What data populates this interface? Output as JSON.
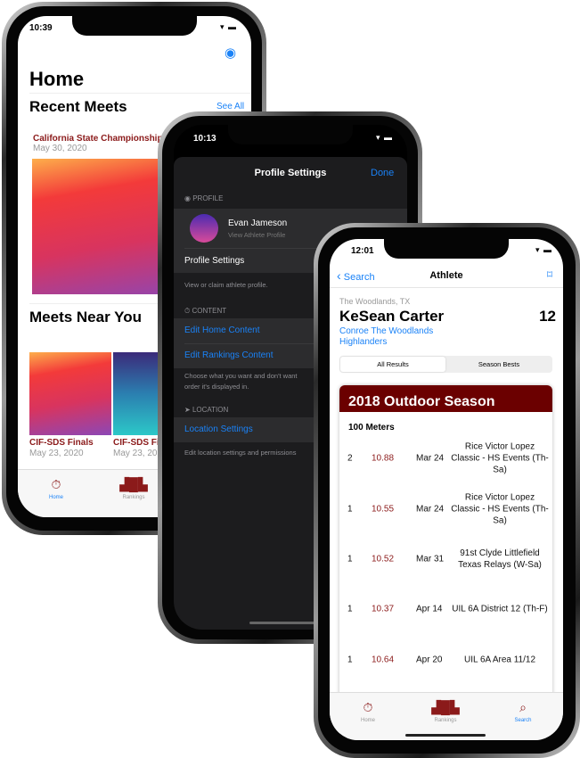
{
  "home_phone": {
    "time": "10:39",
    "title": "Home",
    "recent_meets": {
      "title": "Recent Meets",
      "see_all": "See All",
      "meet": {
        "name": "California State Championship",
        "date": "May 30, 2020"
      }
    },
    "meets_near_you": {
      "title": "Meets Near You",
      "items": [
        {
          "name": "CIF-SDS Finals",
          "date": "May 23, 2020"
        },
        {
          "name": "CIF-SDS Finals",
          "date": "May 23, 2020"
        }
      ]
    },
    "tabs": [
      {
        "label": "Home",
        "icon": "stopwatch-icon",
        "active": true
      },
      {
        "label": "Rankings",
        "icon": "podium-icon",
        "active": false
      }
    ]
  },
  "settings_phone": {
    "time": "10:13",
    "title": "Profile Settings",
    "done": "Done",
    "profile_section": {
      "header": "PROFILE",
      "name": "Evan Jameson",
      "subtitle": "View Athlete Profile",
      "settings_row": "Profile Settings",
      "footer": "View or claim athlete profile."
    },
    "content_section": {
      "header": "CONTENT",
      "rows": [
        "Edit Home Content",
        "Edit Rankings Content"
      ],
      "footer_lines": [
        "Choose what you want and don't want",
        "order it's displayed in."
      ]
    },
    "location_section": {
      "header": "LOCATION",
      "row": "Location Settings",
      "footer": "Edit location settings and permissions"
    }
  },
  "athlete_phone": {
    "time": "12:01",
    "back": "Search",
    "title": "Athlete",
    "location": "The Woodlands, TX",
    "name": "KeSean Carter",
    "grade": "12",
    "school_lines": [
      "Conroe The Woodlands",
      "Highlanders"
    ],
    "segments": [
      "All Results",
      "Season Bests"
    ],
    "season": "2018 Outdoor Season",
    "event": "100 Meters",
    "results": [
      {
        "place": "2",
        "mark": "10.88",
        "date": "Mar 24",
        "meet": "Rice Victor Lopez Classic - HS Events (Th-Sa)"
      },
      {
        "place": "1",
        "mark": "10.55",
        "date": "Mar 24",
        "meet": "Rice Victor Lopez Classic - HS Events (Th-Sa)"
      },
      {
        "place": "1",
        "mark": "10.52",
        "date": "Mar 31",
        "meet": "91st Clyde Littlefield Texas Relays (W-Sa)"
      },
      {
        "place": "1",
        "mark": "10.37",
        "date": "Apr 14",
        "meet": "UIL 6A District 12 (Th-F)"
      },
      {
        "place": "1",
        "mark": "10.64",
        "date": "Apr 20",
        "meet": "UIL 6A Area 11/12"
      }
    ],
    "tabs": [
      {
        "label": "Home",
        "icon": "stopwatch-icon"
      },
      {
        "label": "Rankings",
        "icon": "podium-icon"
      },
      {
        "label": "Search",
        "icon": "search-icon",
        "active": true
      }
    ]
  },
  "colors": {
    "maroon": "#8b1a1a",
    "season_header": "#6b0000",
    "link_blue": "#1a82f7",
    "dark_bg": "#1c1c1e"
  }
}
